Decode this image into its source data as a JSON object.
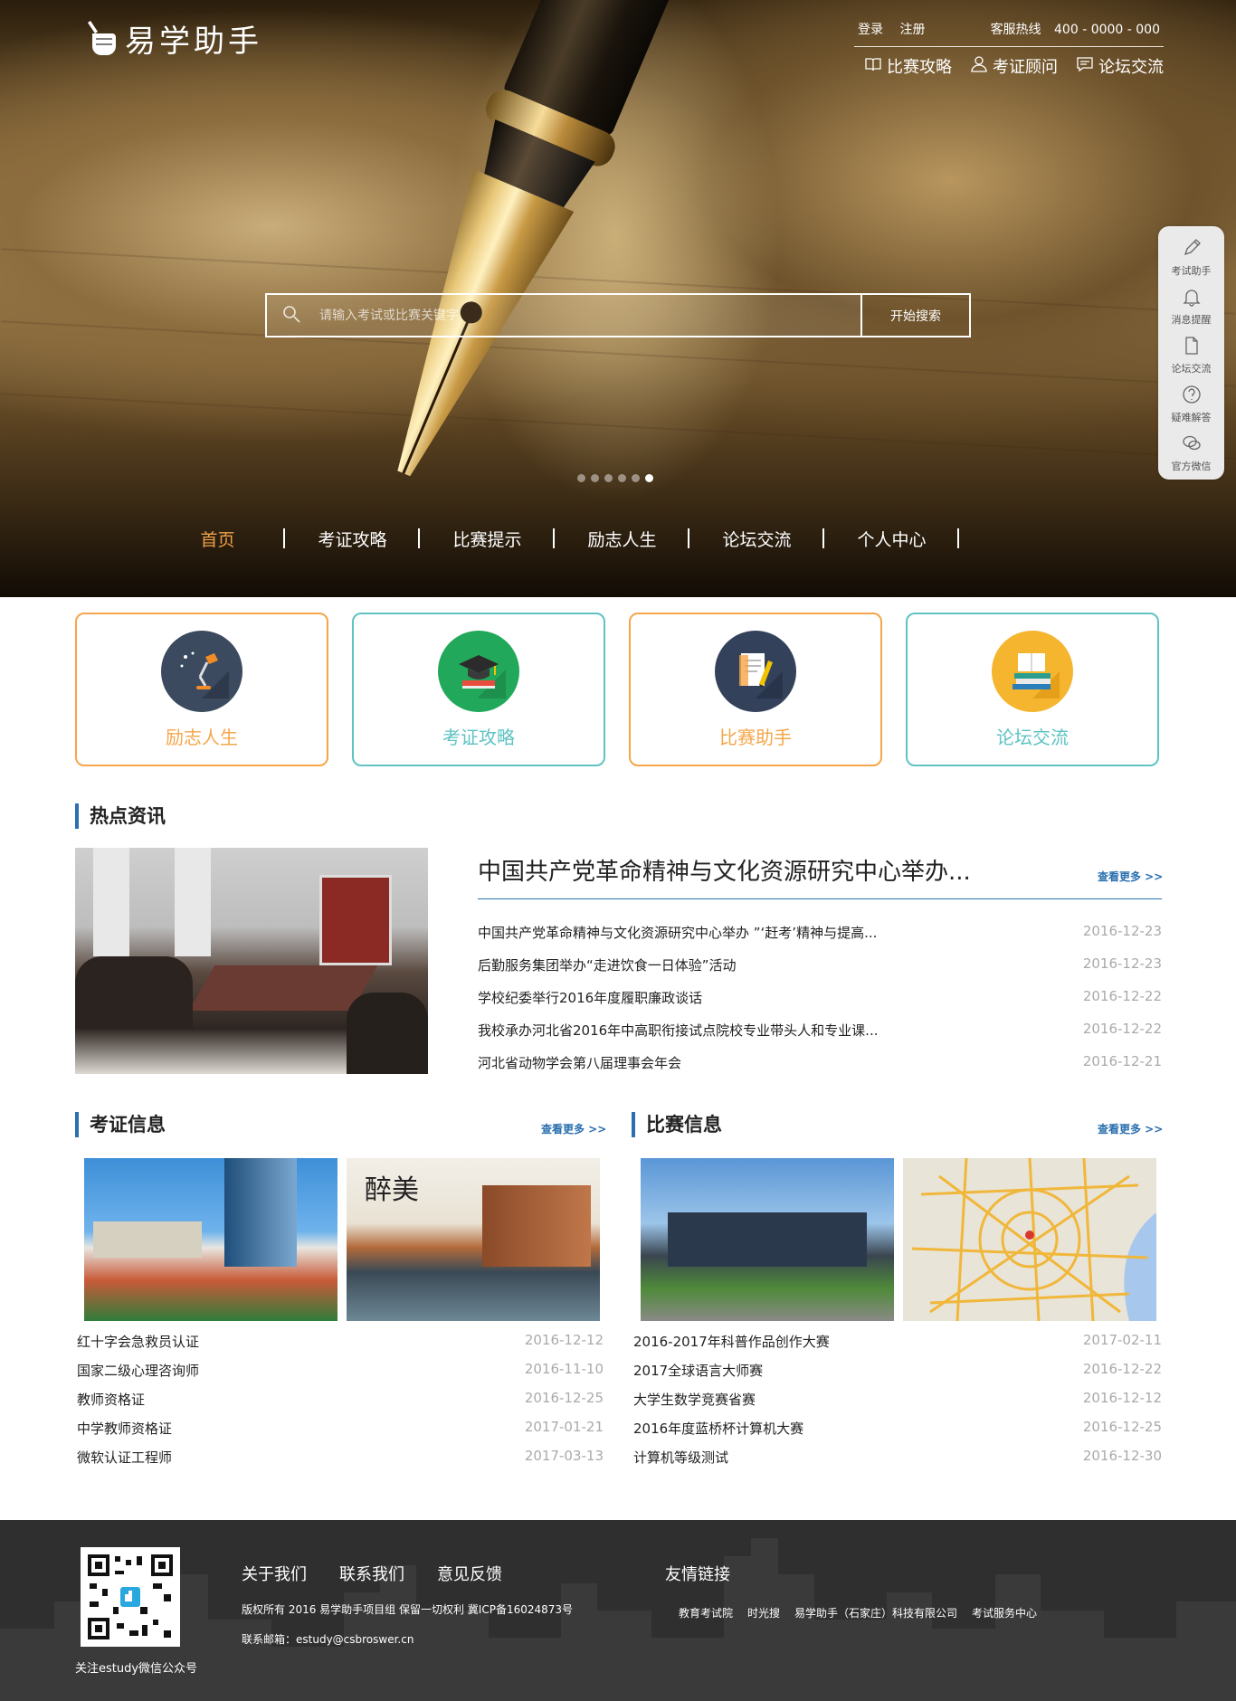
{
  "header": {
    "logo_text": "易学助手",
    "auth": {
      "login": "登录",
      "register": "注册"
    },
    "hotline_label": "客服热线",
    "hotline": "400 - 0000 - 000",
    "quick_links": [
      {
        "label": "比赛攻略",
        "icon": "book-icon"
      },
      {
        "label": "考证顾问",
        "icon": "user-icon"
      },
      {
        "label": "论坛交流",
        "icon": "chat-icon"
      }
    ]
  },
  "search": {
    "placeholder": "请输入考试或比赛关键字",
    "button": "开始搜索"
  },
  "carousel": {
    "count": 6,
    "active": 6
  },
  "nav": [
    {
      "label": "首页",
      "active": true
    },
    {
      "label": "考证攻略"
    },
    {
      "label": "比赛提示"
    },
    {
      "label": "励志人生"
    },
    {
      "label": "论坛交流"
    },
    {
      "label": "个人中心"
    }
  ],
  "sidebar": [
    {
      "label": "考试助手",
      "icon": "pen-icon"
    },
    {
      "label": "消息提醒",
      "icon": "bell-icon"
    },
    {
      "label": "论坛交流",
      "icon": "document-icon"
    },
    {
      "label": "疑难解答",
      "icon": "question-icon"
    },
    {
      "label": "官方微信",
      "icon": "wechat-icon"
    }
  ],
  "feature_cards": [
    {
      "label": "励志人生",
      "icon": "lamp-icon",
      "border": "#f5a64a",
      "text": "#f5a64a",
      "bg": "#3b4a5e"
    },
    {
      "label": "考证攻略",
      "icon": "graduation-cap-icon",
      "border": "#5fc3c3",
      "text": "#5fc3c3",
      "bg": "#22a85a"
    },
    {
      "label": "比赛助手",
      "icon": "notebook-icon",
      "border": "#f5a64a",
      "text": "#f5a64a",
      "bg": "#33425a"
    },
    {
      "label": "论坛交流",
      "icon": "books-icon",
      "border": "#5fc3c3",
      "text": "#5fc3c3",
      "bg": "#f5b52e"
    }
  ],
  "hot_news": {
    "title": "热点资讯",
    "headline": "中国共产党革命精神与文化资源研究中心举办...",
    "more": "查看更多 >>",
    "items": [
      {
        "title": "中国共产党革命精神与文化资源研究中心举办 ”‘赶考’精神与提高...",
        "date": "2016-12-23"
      },
      {
        "title": "后勤服务集团举办“走进饮食一日体验”活动",
        "date": "2016-12-23"
      },
      {
        "title": "学校纪委举行2016年度履职廉政谈话",
        "date": "2016-12-22"
      },
      {
        "title": "我校承办河北省2016年中高职衔接试点院校专业带头人和专业课...",
        "date": "2016-12-22"
      },
      {
        "title": "河北省动物学会第八届理事会年会",
        "date": "2016-12-21"
      }
    ]
  },
  "cert_info": {
    "title": "考证信息",
    "more": "查看更多 >>",
    "items": [
      {
        "title": "红十字会急救员认证",
        "date": "2016-12-12"
      },
      {
        "title": "国家二级心理咨询师",
        "date": "2016-11-10"
      },
      {
        "title": "教师资格证",
        "date": "2016-12-25"
      },
      {
        "title": "中学教师资格证",
        "date": "2017-01-21"
      },
      {
        "title": "微软认证工程师",
        "date": "2017-03-13"
      }
    ]
  },
  "contest_info": {
    "title": "比赛信息",
    "more": "查看更多 >>",
    "items": [
      {
        "title": "2016-2017年科普作品创作大赛",
        "date": "2017-02-11"
      },
      {
        "title": "2017全球语言大师赛",
        "date": "2016-12-22"
      },
      {
        "title": "大学生数学竞赛省赛",
        "date": "2016-12-12"
      },
      {
        "title": "2016年度蓝桥杯计算机大赛",
        "date": "2016-12-25"
      },
      {
        "title": "计算机等级测试",
        "date": "2016-12-30"
      }
    ]
  },
  "footer": {
    "qr_caption": "关注estudy微信公众号",
    "links": [
      "关于我们",
      "联系我们",
      "意见反馈"
    ],
    "copyright": "版权所有 2016 易学助手项目组 保留一切权利 冀ICP备16024873号",
    "email": "联系邮箱：estudy@csbroswer.cn",
    "friend_title": "友情链接",
    "friends": [
      "教育考试院",
      "时光搜",
      "易学助手（石家庄）科技有限公司",
      "考试服务中心"
    ]
  }
}
